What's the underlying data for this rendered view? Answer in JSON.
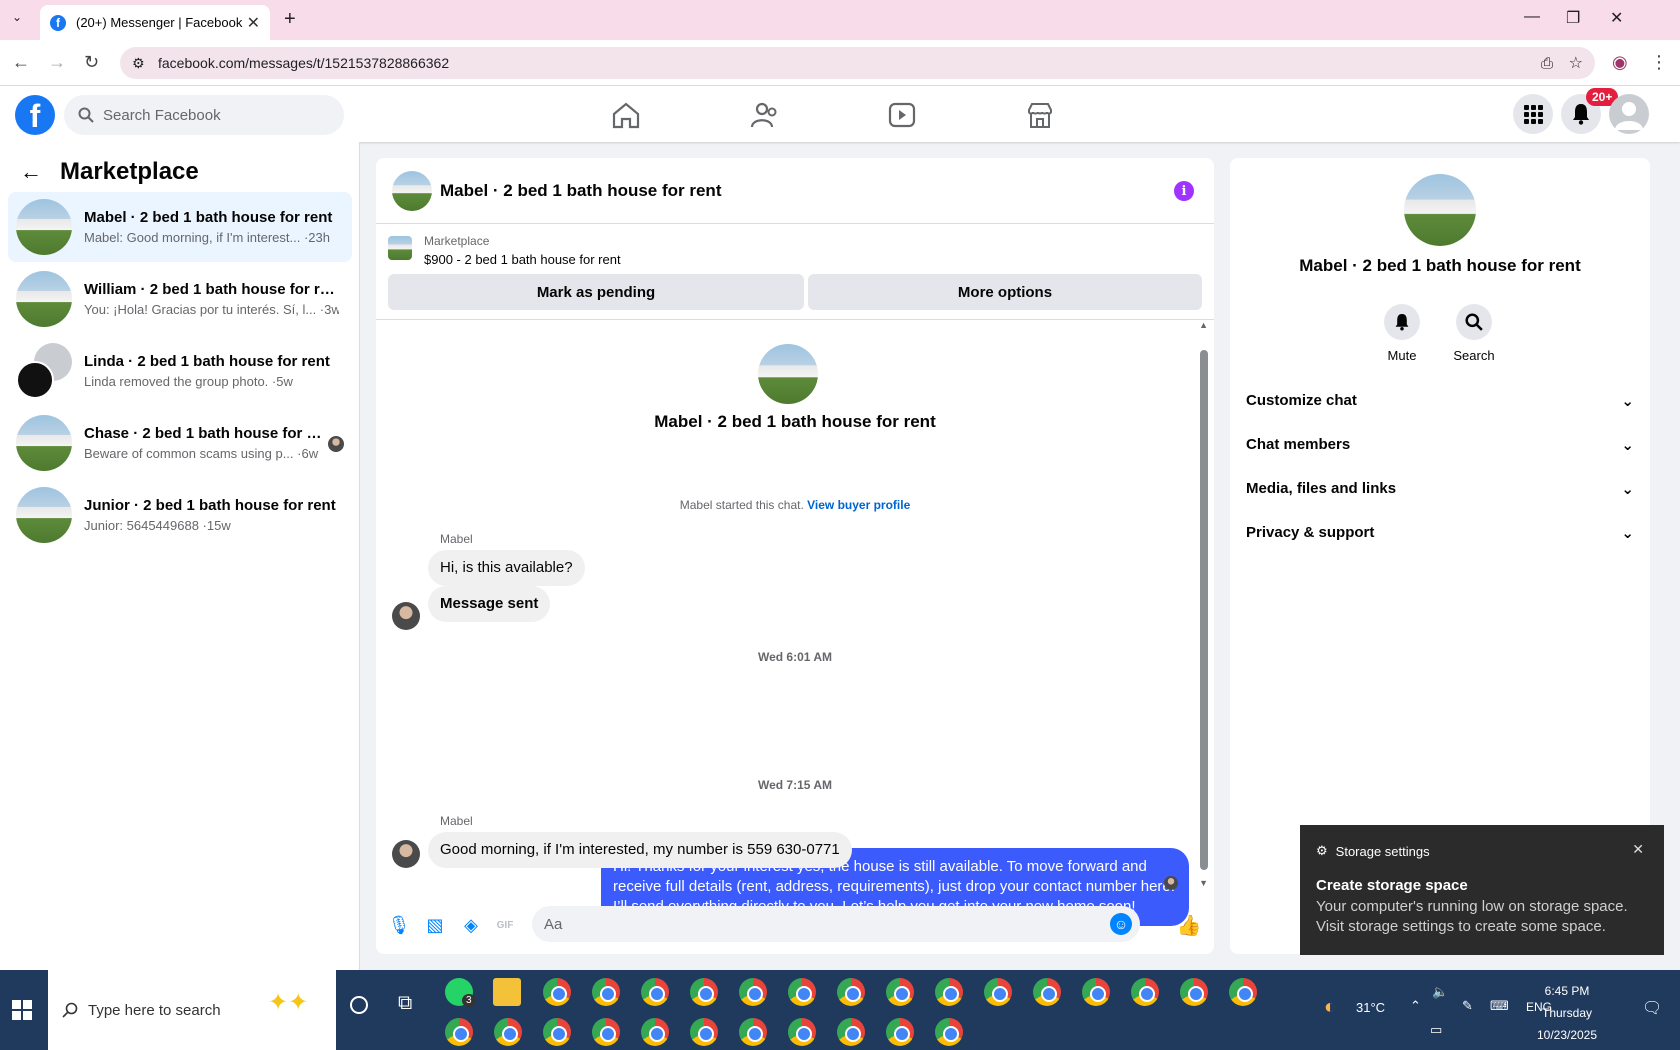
{
  "browser": {
    "tab_title": "(20+) Messenger | Facebook",
    "url": "facebook.com/messages/t/1521537828866362"
  },
  "fb": {
    "search_placeholder": "Search Facebook",
    "notif_badge": "20+"
  },
  "left": {
    "title": "Marketplace",
    "conversations": [
      {
        "name": "Mabel · 2 bed 1 bath house for rent",
        "preview": "Mabel: Good morning, if I'm interest... ·23h"
      },
      {
        "name": "William · 2 bed 1 bath house for rent",
        "preview": "You: ¡Hola! Gracias por tu interés. Sí, l... ·3w"
      },
      {
        "name": "Linda · 2 bed 1 bath house for rent",
        "preview": "Linda removed the group photo. ·5w"
      },
      {
        "name": "Chase · 2 bed 1 bath house for r...",
        "preview": "Beware of common scams using p... ·6w"
      },
      {
        "name": "Junior · 2 bed 1 bath house for rent",
        "preview": "Junior: 5645449688 ·15w"
      }
    ]
  },
  "chat": {
    "title": "Mabel · 2 bed 1 bath house for rent",
    "marketplace_label": "Marketplace",
    "listing": "$900 - 2 bed 1 bath house for rent",
    "btn_pending": "Mark as pending",
    "btn_more": "More options",
    "intro_title": "Mabel · 2 bed 1 bath house for rent",
    "started": "Mabel started this chat.",
    "view_profile": "View buyer profile",
    "sender1": "Mabel",
    "msg1": "Hi, is this available?",
    "msg2": "Message sent",
    "time1": "Wed 6:01 AM",
    "outgoing": "Hi! Thanks for your interest yes, the house is still available. To move forward and receive full details (rent, address, requirements), just drop your contact number here. I’ll send everything directly to you. Let’s help you get into your new home soon!",
    "time2": "Wed 7:15 AM",
    "sender2": "Mabel",
    "msg3": "Good morning, if I'm interested, my number is 559 630-0771",
    "composer_placeholder": "Aa"
  },
  "right": {
    "title": "Mabel · 2 bed 1 bath house for rent",
    "mute": "Mute",
    "search": "Search",
    "sections": [
      "Customize chat",
      "Chat members",
      "Media, files and links",
      "Privacy & support"
    ]
  },
  "notification": {
    "header": "Storage settings",
    "title": "Create storage space",
    "body": "Your computer's running low on storage space. Visit storage settings to create some space."
  },
  "taskbar": {
    "search_placeholder": "Type here to search",
    "whatsapp_badge": "3",
    "temp": "31°C",
    "lang": "ENG",
    "time": "6:45 PM",
    "day": "Thursday",
    "date": "10/23/2025"
  }
}
